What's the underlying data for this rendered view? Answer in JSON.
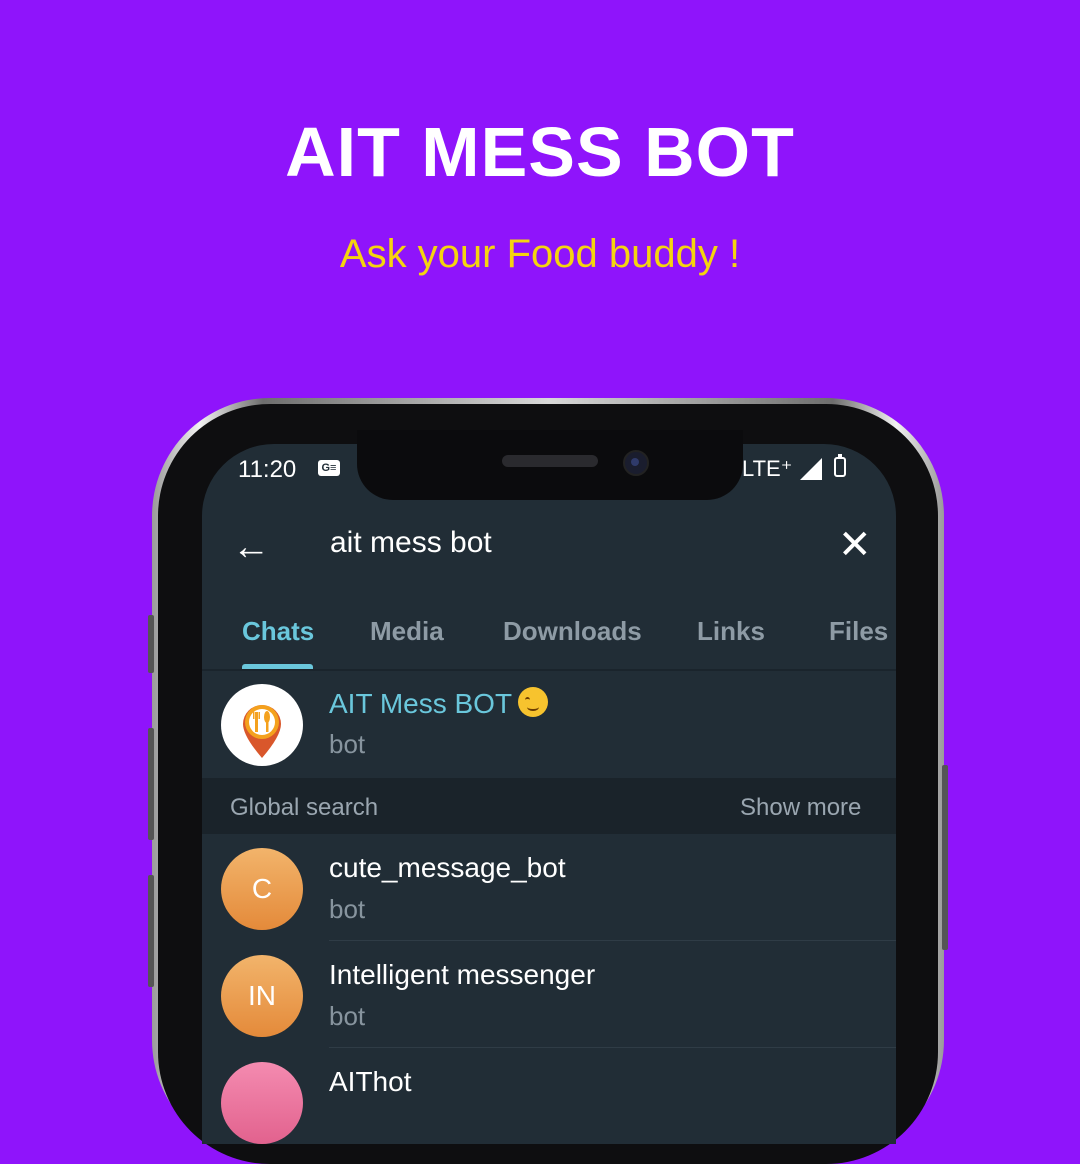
{
  "headline": "AIT MESS BOT",
  "tagline": "Ask your Food buddy !",
  "colors": {
    "background": "#8f14fb",
    "tagline": "#f5d40f",
    "accent": "#6ac7dc",
    "screen_bg": "#212d36"
  },
  "status_bar": {
    "time": "11:20",
    "g_icon_text": "G≡",
    "network": "LTE⁺"
  },
  "search": {
    "query": "ait mess bot",
    "back_icon": "arrow-left-icon",
    "clear_icon": "close-icon"
  },
  "tabs": [
    {
      "label": "Chats",
      "active": true
    },
    {
      "label": "Media",
      "active": false
    },
    {
      "label": "Downloads",
      "active": false
    },
    {
      "label": "Links",
      "active": false
    },
    {
      "label": "Files",
      "active": false
    }
  ],
  "top_result": {
    "title": "AIT Mess BOT",
    "subtitle": "bot",
    "emoji": "face-savoring-food"
  },
  "global_search": {
    "label": "Global search",
    "show_more": "Show more"
  },
  "results": [
    {
      "avatar_text": "C",
      "title": "cute_message_bot",
      "subtitle": "bot"
    },
    {
      "avatar_text": "IN",
      "title": "Intelligent messenger",
      "subtitle": "bot"
    },
    {
      "avatar_text": "",
      "title": "AIThot",
      "subtitle": ""
    }
  ]
}
